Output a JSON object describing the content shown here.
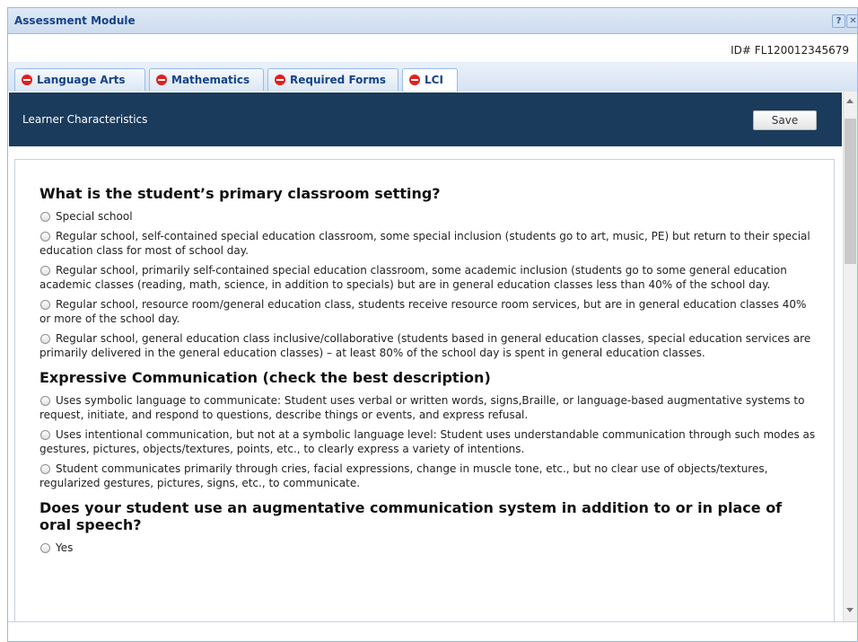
{
  "window": {
    "title": "Assessment Module",
    "help_label": "?",
    "close_label": "✕"
  },
  "student_id": "ID# FL120012345679",
  "tabs": [
    {
      "label": "Language Arts",
      "icon": "red-minus-icon"
    },
    {
      "label": "Mathematics",
      "icon": "red-minus-icon"
    },
    {
      "label": "Required Forms",
      "icon": "red-minus-icon"
    },
    {
      "label": "LCI",
      "icon": "red-minus-icon",
      "active": true
    }
  ],
  "panel": {
    "title": "Learner Characteristics",
    "save_label": "Save"
  },
  "questions": [
    {
      "title": "What is the student’s primary classroom setting?",
      "options": [
        "Special school",
        "Regular school, self-contained special education classroom, some special inclusion (students go to art, music, PE) but return to their special education class for most of school day.",
        "Regular school, primarily self-contained special education classroom, some academic inclusion (students go to some general education academic classes (reading, math, science, in addition to specials) but are in general education classes less than 40% of the school day.",
        "Regular school, resource room/general education class, students receive resource room services, but are in general education classes 40% or more of the school day.",
        "Regular school, general education class inclusive/collaborative (students based in general education classes, special education services are primarily delivered in the general education classes) – at least 80% of the school day is spent in general education classes."
      ]
    },
    {
      "title": "Expressive Communication (check the best description)",
      "options": [
        "Uses symbolic language to communicate: Student uses verbal or written words, signs,Braille, or language-based augmentative systems to request, initiate, and respond to questions, describe things or events, and express refusal.",
        "Uses intentional communication, but not at a symbolic language level: Student uses understandable communication through such modes as gestures, pictures, objects/textures, points, etc., to clearly express a variety of intentions.",
        "Student communicates primarily through cries, facial expressions, change in muscle tone, etc., but no clear use of objects/textures, regularized gestures, pictures, signs, etc., to communicate."
      ]
    },
    {
      "title": "Does your student use an augmentative communication system in addition to or in place of oral speech?",
      "options": [
        "Yes"
      ]
    }
  ],
  "colors": {
    "header_bg": "#1a3b5c",
    "tab_icon": "#e02020",
    "title_text": "#15428b"
  }
}
